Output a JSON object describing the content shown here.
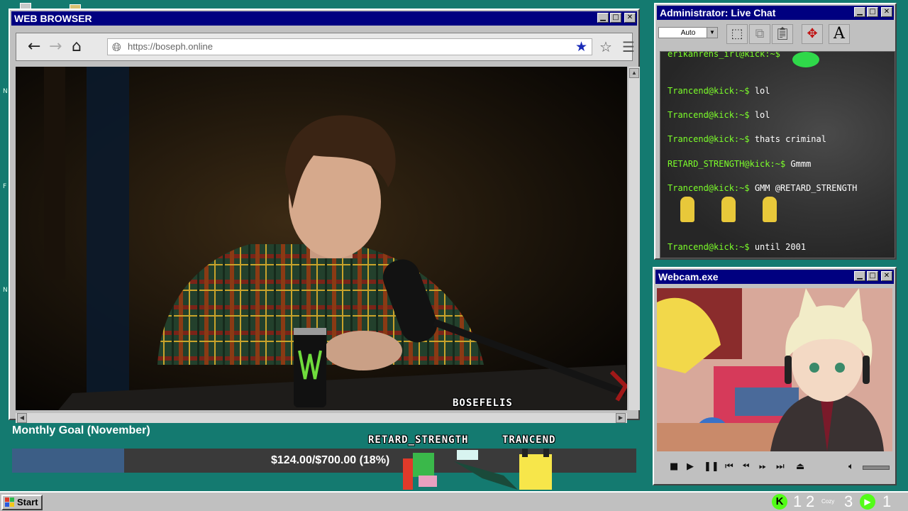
{
  "browser": {
    "title": "WEB BROWSER",
    "url": "https://boseph.online",
    "watermark": "BOSEFELIS"
  },
  "chat": {
    "title": "Administrator: Live Chat",
    "font_select": "Auto",
    "top_partial": "erikahrens_irl@kick:~$",
    "messages": [
      {
        "user": "Trancend@kick:~$",
        "text": "lol"
      },
      {
        "user": "Trancend@kick:~$",
        "text": "lol"
      },
      {
        "user": "Trancend@kick:~$",
        "text": "thats criminal"
      },
      {
        "user": "RETARD_STRENGTH@kick:~$",
        "text": "Gmmm"
      },
      {
        "user": "Trancend@kick:~$",
        "text": "GMM @RETARD_STRENGTH"
      },
      {
        "user": "Trancend@kick:~$",
        "text": "until 2001"
      }
    ],
    "font_tool": "A"
  },
  "webcam": {
    "title": "Webcam.exe"
  },
  "goal": {
    "title": "Monthly Goal (November)",
    "amount_text": "$124.00/$700.00 (18%)",
    "progress": 0.18
  },
  "characters": {
    "left_name": "RETARD_STRENGTH",
    "right_name": "TRANCEND"
  },
  "taskbar": {
    "start_label": "Start",
    "tray_numbers": [
      "1",
      "2",
      "3",
      "1"
    ],
    "tray_small": "Cozy"
  },
  "colors": {
    "desktop": "#147a70",
    "titlebar": "#000080",
    "chat_user": "#7cff2a",
    "goal_fill": "#3c5e86"
  }
}
